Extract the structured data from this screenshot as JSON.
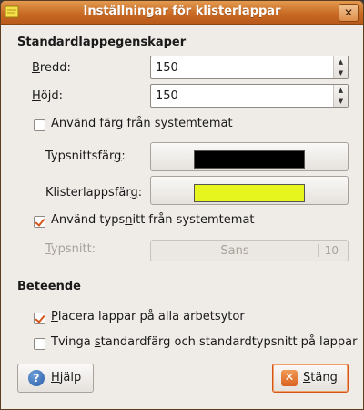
{
  "window": {
    "title": "Inställningar för klisterlappar",
    "close_glyph": "✕"
  },
  "defaults": {
    "heading": "Standardlappegenskaper",
    "width": {
      "label_first": "B",
      "label_rest": "redd",
      "value": "150"
    },
    "height": {
      "label_first": "H",
      "label_rest": "öjd",
      "value": "150"
    },
    "use_theme_color": {
      "label_pre": "Använd f",
      "label_u": "ä",
      "label_post": "rg från systemtemat",
      "checked": false
    },
    "font_color": {
      "label_pre": "Typsnittsfär",
      "label_u": "g",
      "label_post": ":",
      "color": "#000000"
    },
    "note_color": {
      "label_pre": "Klisterlappsfär",
      "label_u": "g",
      "label_post": ":",
      "color": "#e6f51e"
    },
    "use_theme_font": {
      "label_pre": "Använd typs",
      "label_u": "n",
      "label_post": "itt från systemtemat",
      "checked": true
    },
    "font": {
      "label_pre": "",
      "label_u": "T",
      "label_post": "ypsnitt:",
      "name": "Sans",
      "size": "10"
    }
  },
  "behavior": {
    "heading": "Beteende",
    "all_workspaces": {
      "label_u": "P",
      "label_rest": "lacera lappar på alla arbetsytor",
      "checked": true
    },
    "force_defaults": {
      "label_pre": "Tvinga ",
      "label_u": "s",
      "label_post": "tandardfärg och standardtypsnitt på lappar",
      "checked": false
    }
  },
  "buttons": {
    "help": {
      "label_u": "H",
      "label_rest": "jälp",
      "icon_glyph": "?"
    },
    "close": {
      "label_u": "S",
      "label_rest": "täng",
      "icon_glyph": "✕"
    }
  }
}
